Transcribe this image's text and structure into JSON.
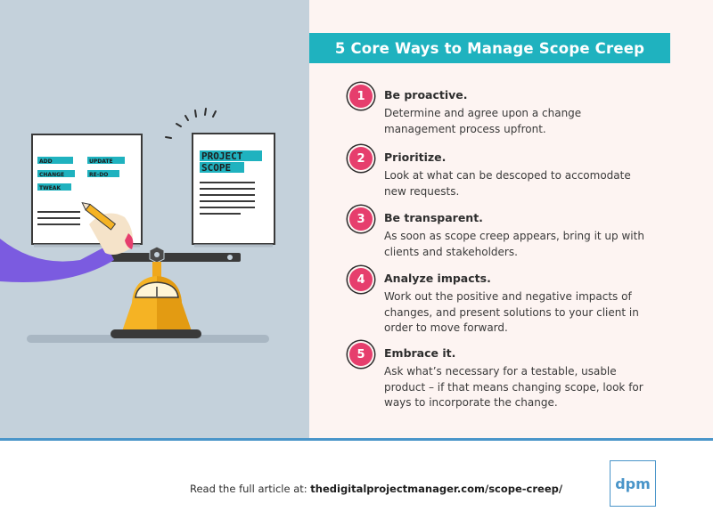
{
  "title": "5 Core Ways to Manage Scope Creep",
  "items": [
    {
      "number": "1",
      "title": "Be proactive.",
      "description": "Determine and agree upon a change management process upfront."
    },
    {
      "number": "2",
      "title": "Prioritize.",
      "description": "Look at what can be descoped to accomodate new requests."
    },
    {
      "number": "3",
      "title": "Be transparent.",
      "description": "As soon as scope creep appears, bring it up with clients and stakeholders."
    },
    {
      "number": "4",
      "title": "Analyze impacts.",
      "description": "Work out the positive and negative impacts of changes, and present solutions to your client in order to move forward."
    },
    {
      "number": "5",
      "title": "Embrace it.",
      "description": "Ask what’s necessary for a testable, usable product – if that means changing scope, look for ways to incorporate the change."
    }
  ],
  "illustration": {
    "left_doc_tags": [
      "ADD",
      "UPDATE",
      "CHANGE",
      "RE-DO",
      "TWEAK"
    ],
    "right_doc_title_line1": "PROJECT",
    "right_doc_title_line2": "SCOPE"
  },
  "footer": {
    "prefix": "Read the full article at: ",
    "url": "thedigitalprojectmanager.com/scope-creep/",
    "logo_text": "dpm"
  },
  "colors": {
    "accent_teal": "#1fb2bf",
    "badge_pink": "#e63e6d",
    "brand_blue": "#4a95c9",
    "scale_yellow": "#f5b324",
    "arm_purple": "#7b5be0"
  }
}
